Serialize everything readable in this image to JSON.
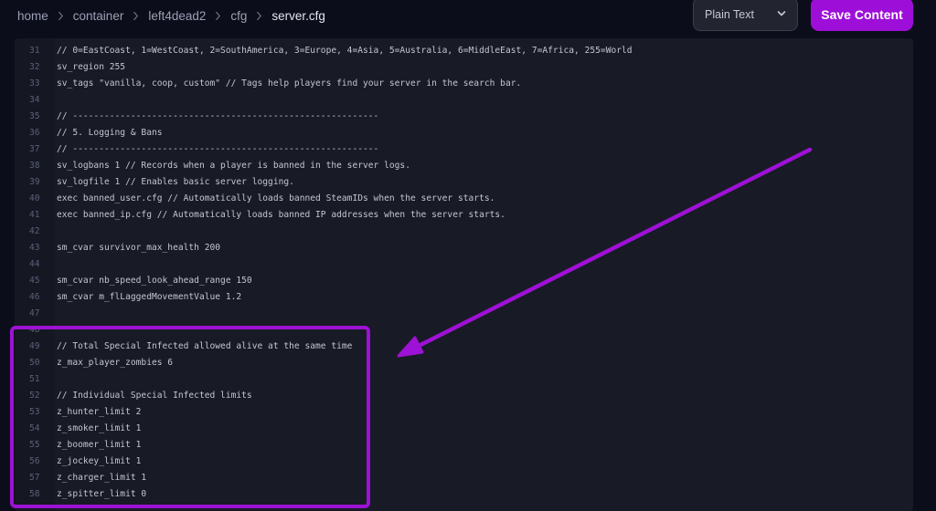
{
  "breadcrumb": [
    {
      "label": "home"
    },
    {
      "label": "container"
    },
    {
      "label": "left4dead2"
    },
    {
      "label": "cfg"
    },
    {
      "label": "server.cfg",
      "current": true
    }
  ],
  "toolbar": {
    "mode_select": "Plain Text",
    "save_label": "Save Content"
  },
  "editor": {
    "lines": [
      {
        "n": "31",
        "text": "// 0=EastCoast, 1=WestCoast, 2=SouthAmerica, 3=Europe, 4=Asia, 5=Australia, 6=MiddleEast, 7=Africa, 255=World"
      },
      {
        "n": "32",
        "text": "sv_region 255"
      },
      {
        "n": "33",
        "text": "sv_tags \"vanilla, coop, custom\" // Tags help players find your server in the search bar."
      },
      {
        "n": "34",
        "text": ""
      },
      {
        "n": "35",
        "text": "// ----------------------------------------------------------"
      },
      {
        "n": "36",
        "text": "// 5. Logging & Bans"
      },
      {
        "n": "37",
        "text": "// ----------------------------------------------------------"
      },
      {
        "n": "38",
        "text": "sv_logbans 1 // Records when a player is banned in the server logs."
      },
      {
        "n": "39",
        "text": "sv_logfile 1 // Enables basic server logging."
      },
      {
        "n": "40",
        "text": "exec banned_user.cfg // Automatically loads banned SteamIDs when the server starts."
      },
      {
        "n": "41",
        "text": "exec banned_ip.cfg // Automatically loads banned IP addresses when the server starts."
      },
      {
        "n": "42",
        "text": ""
      },
      {
        "n": "43",
        "text": "sm_cvar survivor_max_health 200"
      },
      {
        "n": "44",
        "text": ""
      },
      {
        "n": "45",
        "text": "sm_cvar nb_speed_look_ahead_range 150"
      },
      {
        "n": "46",
        "text": "sm_cvar m_flLaggedMovementValue 1.2"
      },
      {
        "n": "47",
        "text": ""
      },
      {
        "n": "48",
        "text": ""
      },
      {
        "n": "49",
        "text": "// Total Special Infected allowed alive at the same time"
      },
      {
        "n": "50",
        "text": "z_max_player_zombies 6"
      },
      {
        "n": "51",
        "text": ""
      },
      {
        "n": "52",
        "text": "// Individual Special Infected limits"
      },
      {
        "n": "53",
        "text": "z_hunter_limit 2"
      },
      {
        "n": "54",
        "text": "z_smoker_limit 1"
      },
      {
        "n": "55",
        "text": "z_boomer_limit 1"
      },
      {
        "n": "56",
        "text": "z_jockey_limit 1"
      },
      {
        "n": "57",
        "text": "z_charger_limit 1"
      },
      {
        "n": "58",
        "text": "z_spitter_limit 0"
      }
    ]
  },
  "colors": {
    "accent": "#9d0fd8",
    "background": "#0c0d1a",
    "editor_bg": "#181a25",
    "annotation": "#9d12d4"
  },
  "icons": {
    "breadcrumb_separator": "chevron-right-icon",
    "select_caret": "chevron-down-icon"
  }
}
